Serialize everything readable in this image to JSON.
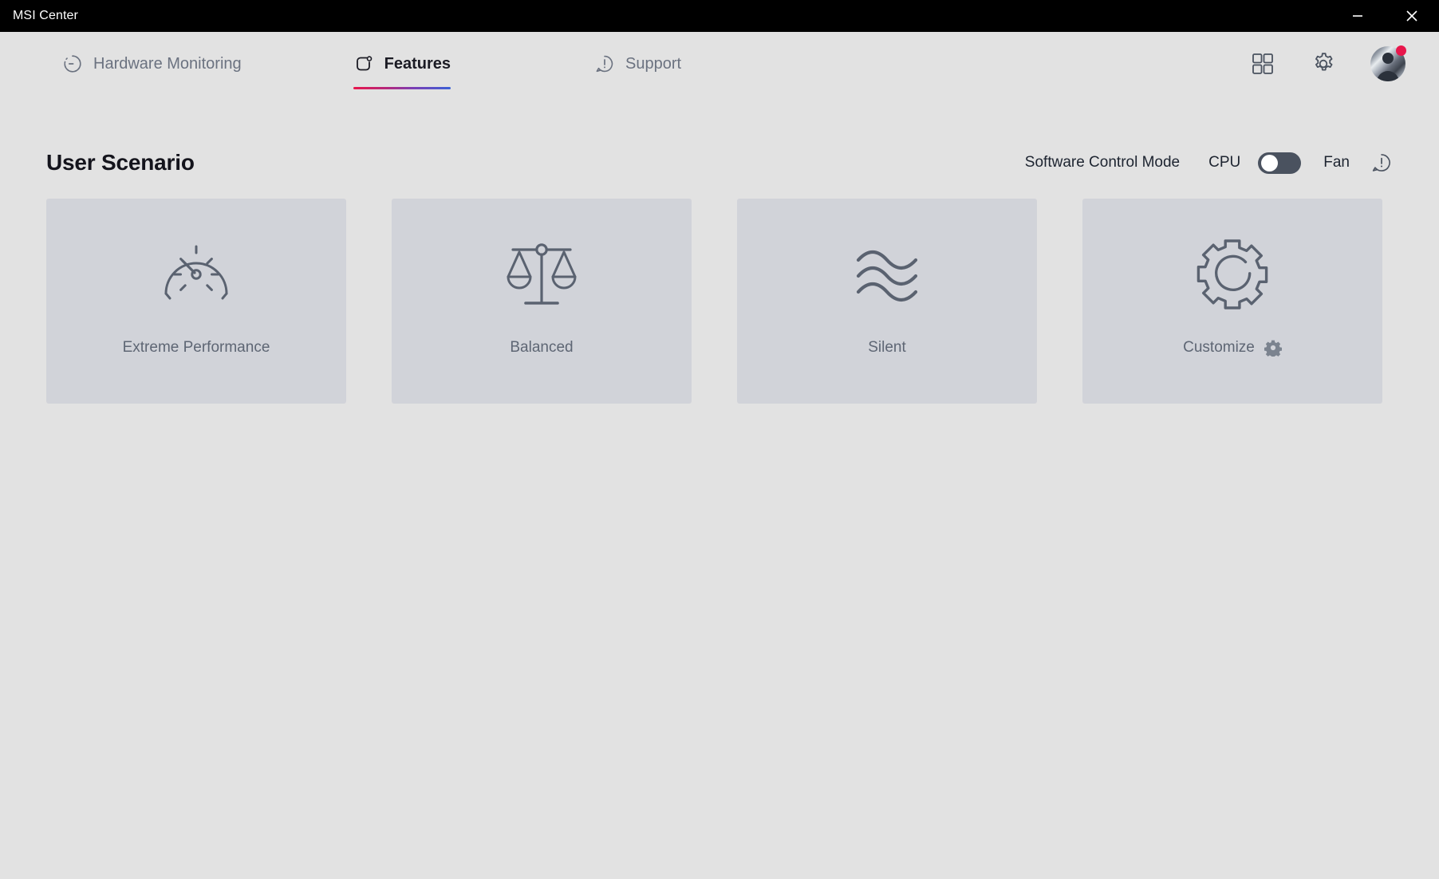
{
  "window": {
    "title": "MSI Center",
    "minimize_label": "Minimize",
    "close_label": "Close"
  },
  "nav": {
    "tabs": [
      {
        "label": "Hardware Monitoring",
        "icon": "hardware-monitoring-icon",
        "active": false
      },
      {
        "label": "Features",
        "icon": "features-icon",
        "active": true
      },
      {
        "label": "Support",
        "icon": "support-icon",
        "active": false
      }
    ],
    "active_tab": "Features",
    "underline_gradient_from": "#e8174c",
    "underline_gradient_to": "#3b61d6",
    "actions": [
      {
        "name": "apps-grid-icon",
        "label": "Apps"
      },
      {
        "name": "settings-gear-icon",
        "label": "Settings"
      },
      {
        "name": "user-avatar",
        "label": "Account",
        "badge": true
      }
    ]
  },
  "main": {
    "section_title": "User Scenario",
    "control_mode": {
      "label": "Software Control Mode",
      "left_option": "CPU",
      "right_option": "Fan",
      "toggle_state": "CPU",
      "toggle_on": false,
      "info_icon": "info-exclamation-icon"
    },
    "scenarios": [
      {
        "label": "Extreme Performance",
        "icon": "speedometer-icon",
        "has_settings": false
      },
      {
        "label": "Balanced",
        "icon": "balance-scale-icon",
        "has_settings": false
      },
      {
        "label": "Silent",
        "icon": "waves-icon",
        "has_settings": false
      },
      {
        "label": "Customize",
        "icon": "gear-icon",
        "has_settings": true
      }
    ]
  },
  "colors": {
    "titlebar_bg": "#000000",
    "app_bg": "#e2e2e2",
    "card_bg": "#d1d3d9",
    "icon_stroke": "#5a6270",
    "accent_red": "#e8174c",
    "accent_blue": "#3b61d6",
    "toggle_track": "#4a525f"
  }
}
